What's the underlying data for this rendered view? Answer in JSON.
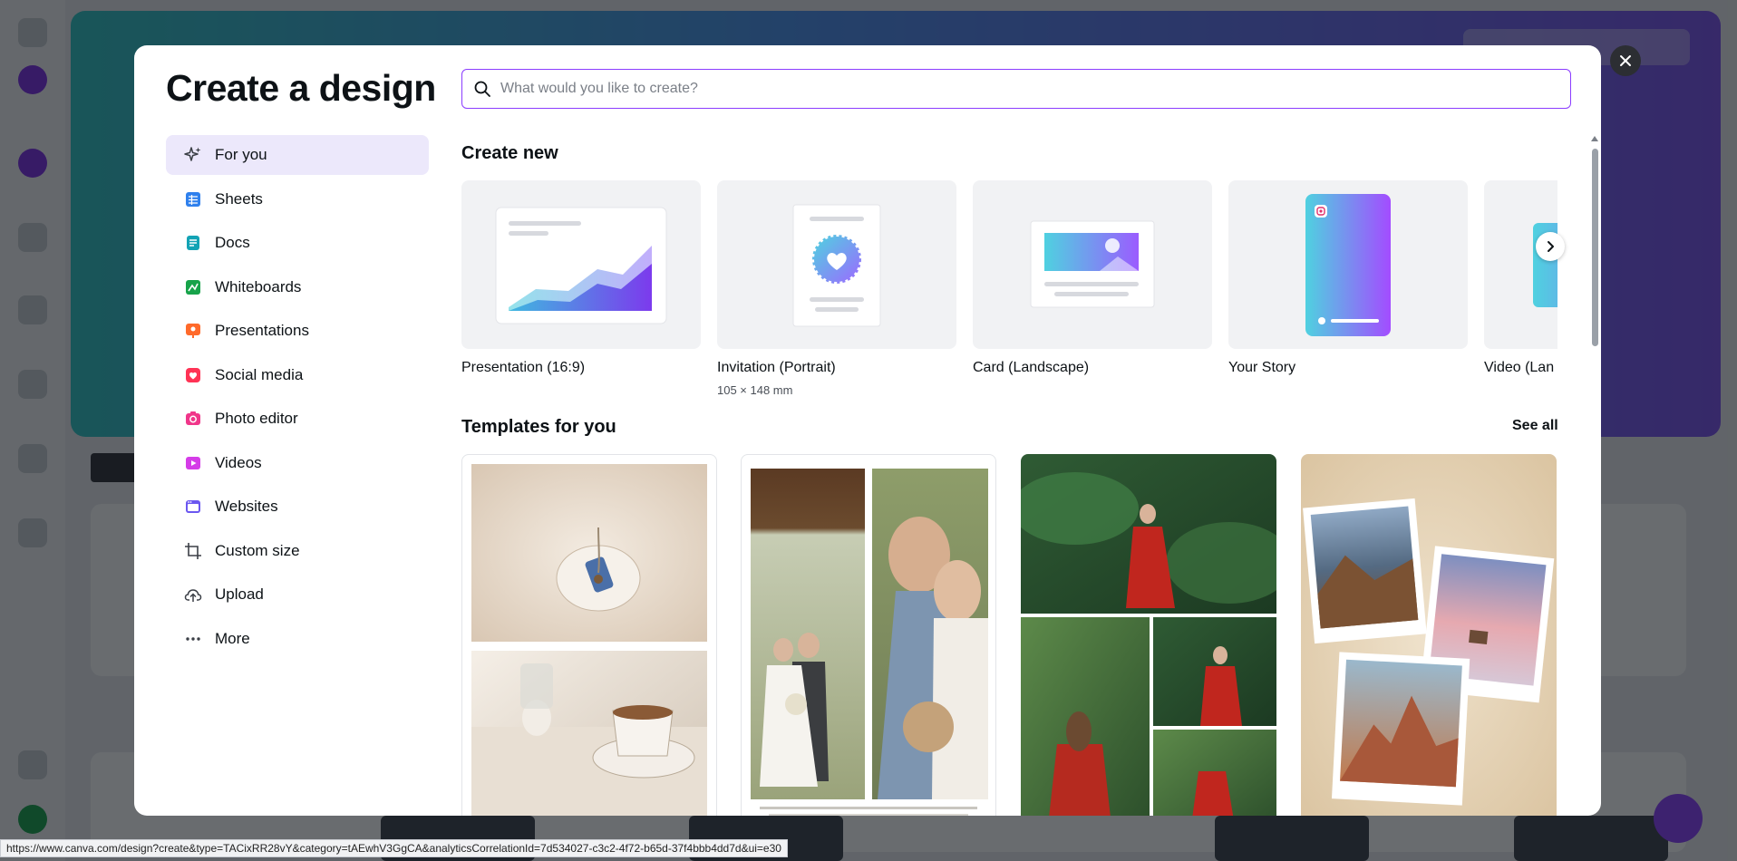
{
  "modal": {
    "title": "Create a design",
    "search_placeholder": "What would you like to create?"
  },
  "sidebar": {
    "items": [
      {
        "label": "For you",
        "icon": "sparkles-icon",
        "color": "#3b3f46",
        "active": true
      },
      {
        "label": "Sheets",
        "icon": "sheets-icon",
        "color": "#2f80ed"
      },
      {
        "label": "Docs",
        "icon": "docs-icon",
        "color": "#13a3b5"
      },
      {
        "label": "Whiteboards",
        "icon": "whiteboard-icon",
        "color": "#17a34a"
      },
      {
        "label": "Presentations",
        "icon": "presentation-icon",
        "color": "#ff6a2b"
      },
      {
        "label": "Social media",
        "icon": "heart-icon",
        "color": "#ff3355"
      },
      {
        "label": "Photo editor",
        "icon": "camera-icon",
        "color": "#f0368a"
      },
      {
        "label": "Videos",
        "icon": "video-icon",
        "color": "#d53ce8"
      },
      {
        "label": "Websites",
        "icon": "website-icon",
        "color": "#6b57f0"
      },
      {
        "label": "Custom size",
        "icon": "crop-icon",
        "color": "#3b3f46"
      },
      {
        "label": "Upload",
        "icon": "upload-cloud-icon",
        "color": "#3b3f46"
      },
      {
        "label": "More",
        "icon": "more-dots-icon",
        "color": "#3b3f46"
      }
    ]
  },
  "create_new": {
    "heading": "Create new",
    "cards": [
      {
        "label": "Presentation (16:9)",
        "sub": ""
      },
      {
        "label": "Invitation (Portrait)",
        "sub": "105 × 148 mm"
      },
      {
        "label": "Card (Landscape)",
        "sub": ""
      },
      {
        "label": "Your Story",
        "sub": ""
      },
      {
        "label": "Video (Lan",
        "sub": ""
      }
    ]
  },
  "templates": {
    "heading": "Templates for you",
    "see_all": "See all"
  },
  "status_bar": {
    "url": "https://www.canva.com/design?create&type=TACixRR28vY&category=tAEwhV3GgCA&analyticsCorrelationId=7d534027-c3c2-4f72-b65d-37f4bbb4dd7d&ui=e30"
  },
  "colors": {
    "accent": "#8b3dff",
    "active_bg": "#ece8fb"
  }
}
